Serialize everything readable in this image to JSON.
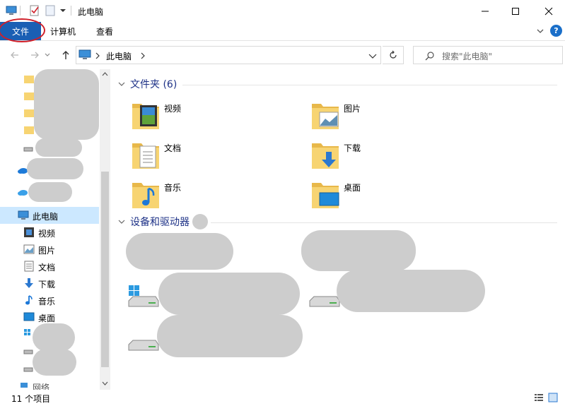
{
  "window": {
    "title": "此电脑",
    "controls": [
      "minimize-icon",
      "maximize-icon",
      "close-icon"
    ]
  },
  "ribbon": {
    "file_tab": "文件",
    "tabs": [
      "计算机",
      "查看"
    ],
    "help": "?"
  },
  "address": {
    "path": "此电脑",
    "search_placeholder": "搜索\"此电脑\""
  },
  "sidebar": {
    "items": [
      {
        "label": "此电脑",
        "icon": "computer-icon",
        "selected": true
      },
      {
        "label": "视频",
        "icon": "video-icon"
      },
      {
        "label": "图片",
        "icon": "picture-icon"
      },
      {
        "label": "文档",
        "icon": "document-icon"
      },
      {
        "label": "下载",
        "icon": "download-icon"
      },
      {
        "label": "音乐",
        "icon": "music-icon"
      },
      {
        "label": "桌面",
        "icon": "desktop-icon"
      },
      {
        "label": "网络",
        "icon": "network-icon"
      }
    ]
  },
  "content": {
    "folders_header": "文件夹 (6)",
    "folders": [
      {
        "name": "视频",
        "icon": "video-folder-icon"
      },
      {
        "name": "图片",
        "icon": "picture-folder-icon"
      },
      {
        "name": "文档",
        "icon": "document-folder-icon"
      },
      {
        "name": "下载",
        "icon": "download-folder-icon"
      },
      {
        "name": "音乐",
        "icon": "music-folder-icon"
      },
      {
        "name": "桌面",
        "icon": "desktop-folder-icon"
      }
    ],
    "devices_header": "设备和驱动器"
  },
  "status": {
    "item_count": "11 个项目"
  },
  "colors": {
    "accent": "#1a5fb4",
    "selected_bg": "#cce8ff",
    "folder": "#f7d472",
    "header_text": "#1e3287",
    "circle_annotation": "#d0202a"
  }
}
